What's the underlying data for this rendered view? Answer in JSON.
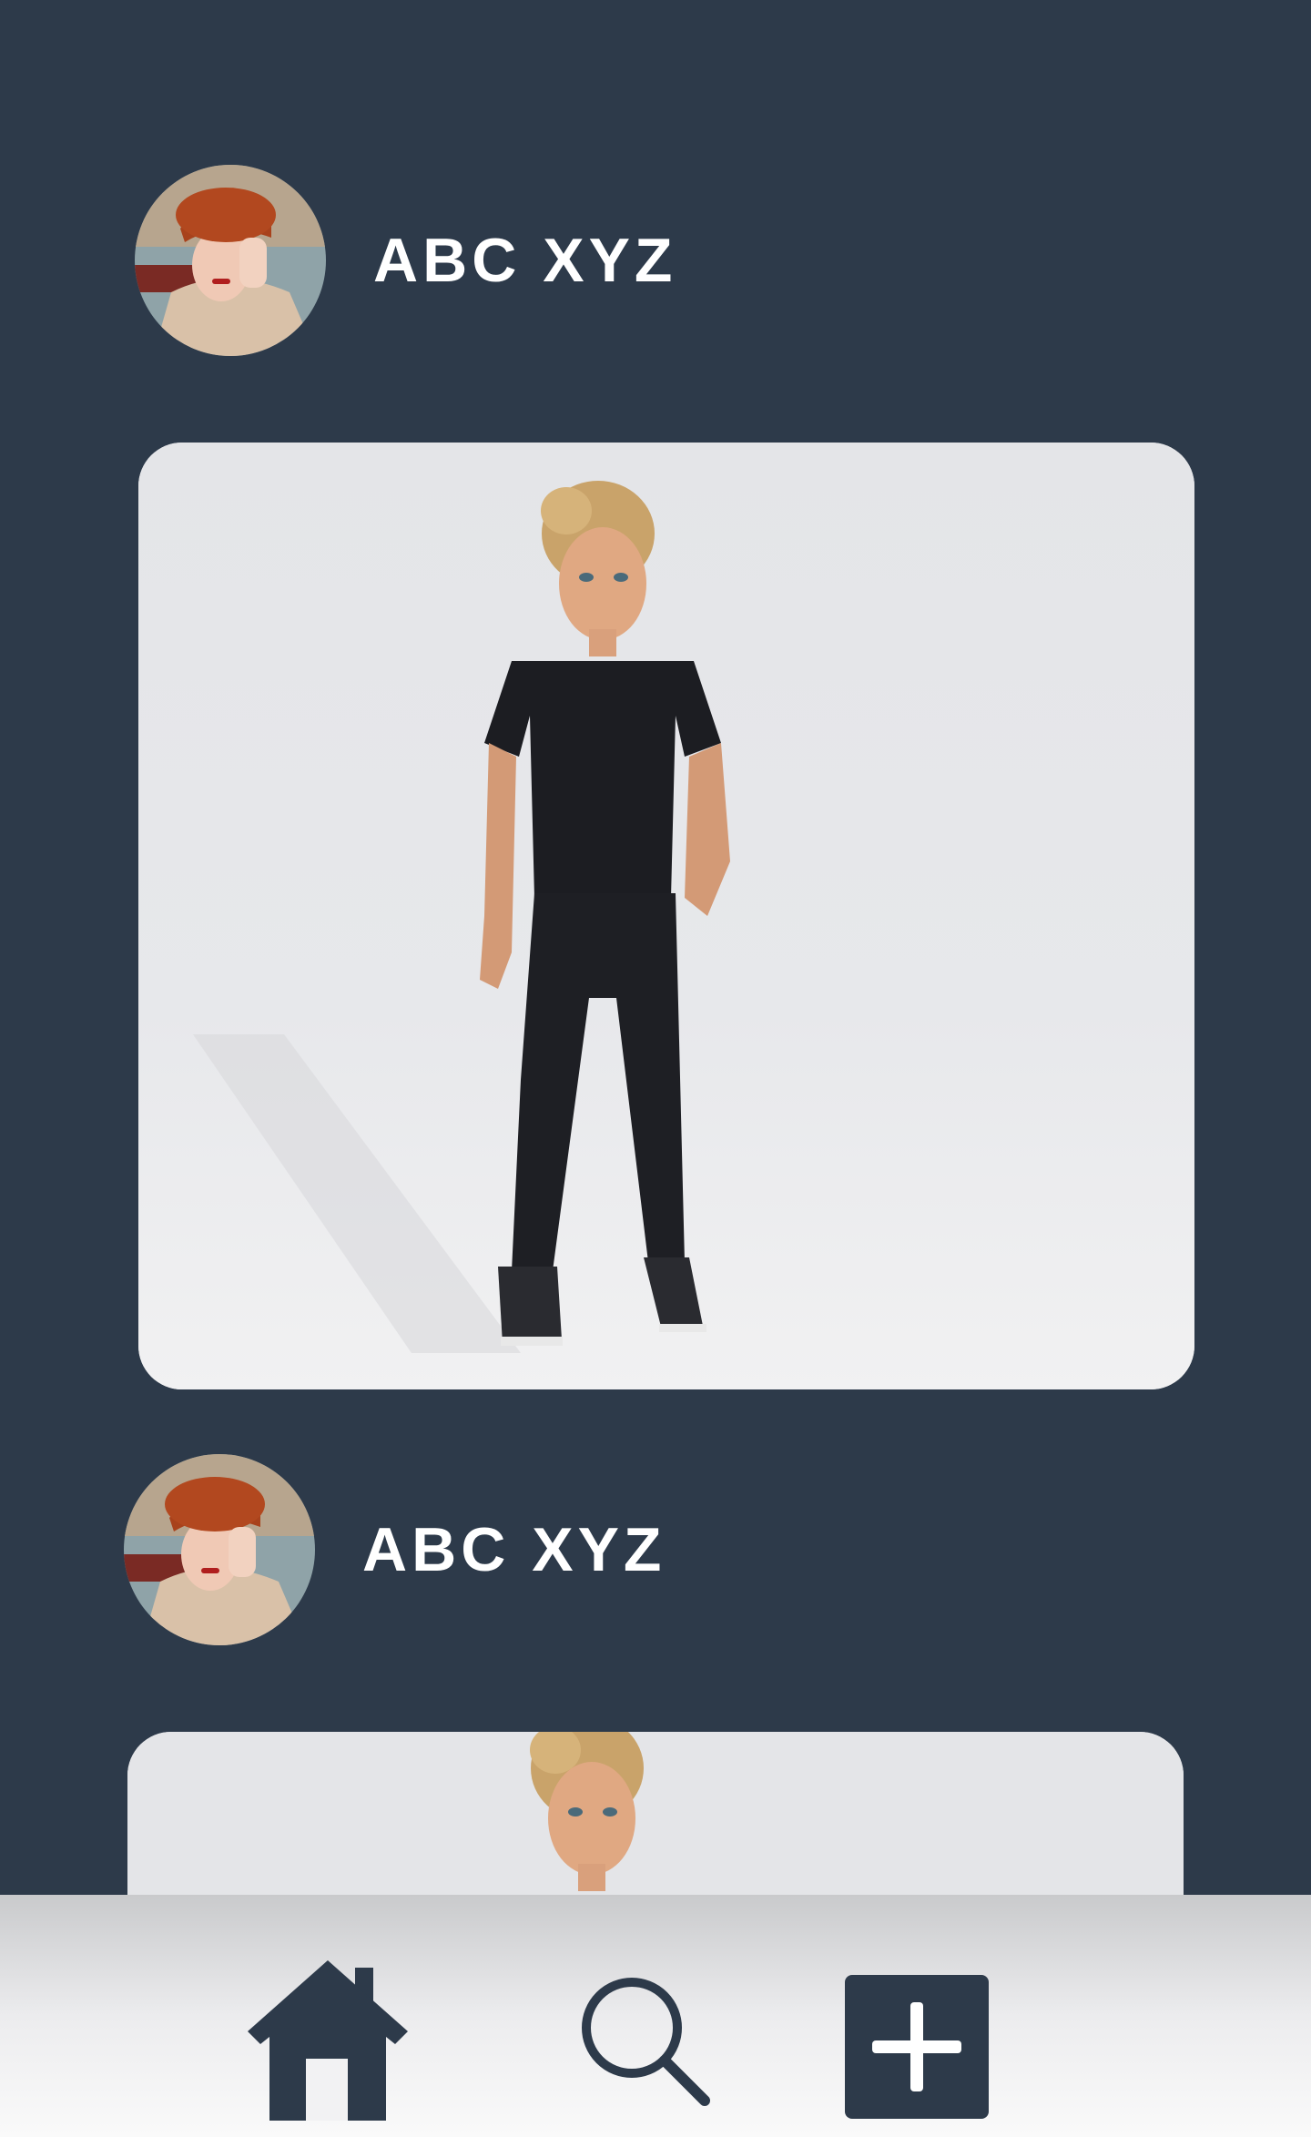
{
  "feed": {
    "posts": [
      {
        "username": "ABC XYZ"
      },
      {
        "username": "ABC XYZ"
      }
    ]
  },
  "bottom_nav": {
    "items": [
      {
        "icon": "home-icon"
      },
      {
        "icon": "search-icon"
      },
      {
        "icon": "add-post-icon"
      }
    ]
  },
  "colors": {
    "background": "#2d3a4a",
    "card_background": "#e6e7ea",
    "nav_background": "#ececee",
    "icon_color": "#2d3a4a",
    "text": "#ffffff"
  }
}
